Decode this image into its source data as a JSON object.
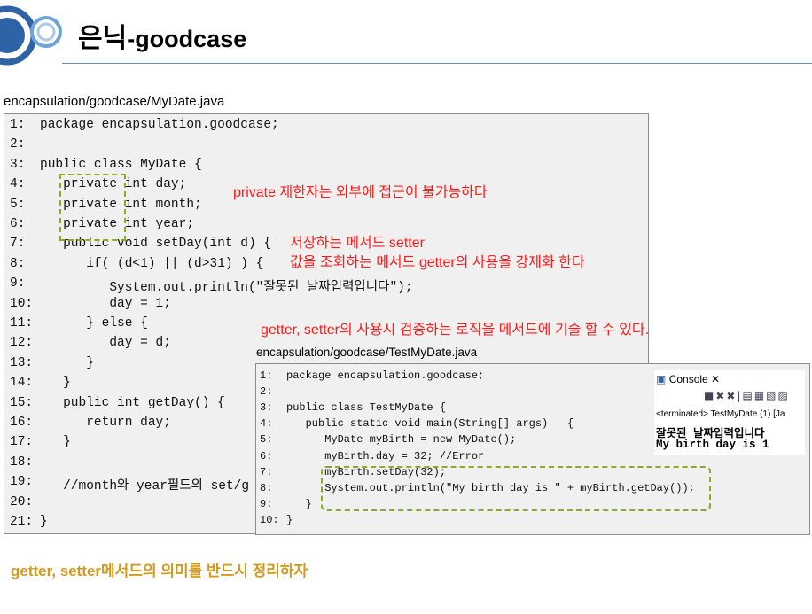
{
  "title": {
    "part1": "은닉",
    "part2": "-goodcase"
  },
  "main_file": {
    "label": "encapsulation/goodcase/MyDate.java",
    "lines": [
      {
        "num": "1:",
        "code": "package encapsulation.goodcase;"
      },
      {
        "num": "2:",
        "code": ""
      },
      {
        "num": "3:",
        "code": "public class MyDate {"
      },
      {
        "num": "4:",
        "code": "   private int day;"
      },
      {
        "num": "5:",
        "code": "   private int month;"
      },
      {
        "num": "6:",
        "code": "   private int year;"
      },
      {
        "num": "7:",
        "code": "   public void setDay(int d) {"
      },
      {
        "num": "8:",
        "code": "      if( (d<1) || (d>31) ) {"
      },
      {
        "num": "9:",
        "code": "         System.out.println(\"잘못된 날짜입력입니다\");"
      },
      {
        "num": "10:",
        "code": "         day = 1;"
      },
      {
        "num": "11:",
        "code": "      } else {"
      },
      {
        "num": "12:",
        "code": "         day = d;"
      },
      {
        "num": "13:",
        "code": "      }"
      },
      {
        "num": "14:",
        "code": "   }"
      },
      {
        "num": "15:",
        "code": "   public int getDay() {"
      },
      {
        "num": "16:",
        "code": "      return day;"
      },
      {
        "num": "17:",
        "code": "   }"
      },
      {
        "num": "18:",
        "code": ""
      },
      {
        "num": "19:",
        "code": "   //month와 year필드의 set/g"
      },
      {
        "num": "20:",
        "code": ""
      },
      {
        "num": "21:",
        "code": "}"
      }
    ]
  },
  "sub_file": {
    "label": "encapsulation/goodcase/TestMyDate.java",
    "lines": [
      {
        "num": "1:",
        "code": "package encapsulation.goodcase;"
      },
      {
        "num": "2:",
        "code": ""
      },
      {
        "num": "3:",
        "code": "public class TestMyDate {"
      },
      {
        "num": "4:",
        "code": "   public static void main(String[] args)   {"
      },
      {
        "num": "5:",
        "code": "      MyDate myBirth = new MyDate();"
      },
      {
        "num": "6:",
        "code": "      myBirth.day = 32; //Error"
      },
      {
        "num": "7:",
        "code": "      myBirth.setDay(32);"
      },
      {
        "num": "8:",
        "code": "      System.out.println(\"My birth day is \" + myBirth.getDay());"
      },
      {
        "num": "9:",
        "code": "   }"
      },
      {
        "num": "10:",
        "code": "}"
      }
    ]
  },
  "notes": {
    "private": "private 제한자는 외부에 접근이 불가능하다",
    "setter": "저장하는 메서드 setter",
    "getter": "값을 조회하는 메서드 getter의 사용을 강제화 한다",
    "validate": "getter, setter의 사용시 검증하는 로직을 메서드에 기술 할 수 있다."
  },
  "console": {
    "tab_label": "Console ✕",
    "terminated": "<terminated> TestMyDate (1) [Ja",
    "output": [
      "잘못된 날짜입력입니다",
      "My birth day is 1"
    ]
  },
  "bottom_note": "getter, setter메서드의 의미를 반드시 정리하자",
  "colors": {
    "note": "#ff1a1a",
    "dash": "#8aaa28",
    "accent_bottom": "#d39a1e",
    "rule": "#6b8fb7"
  }
}
